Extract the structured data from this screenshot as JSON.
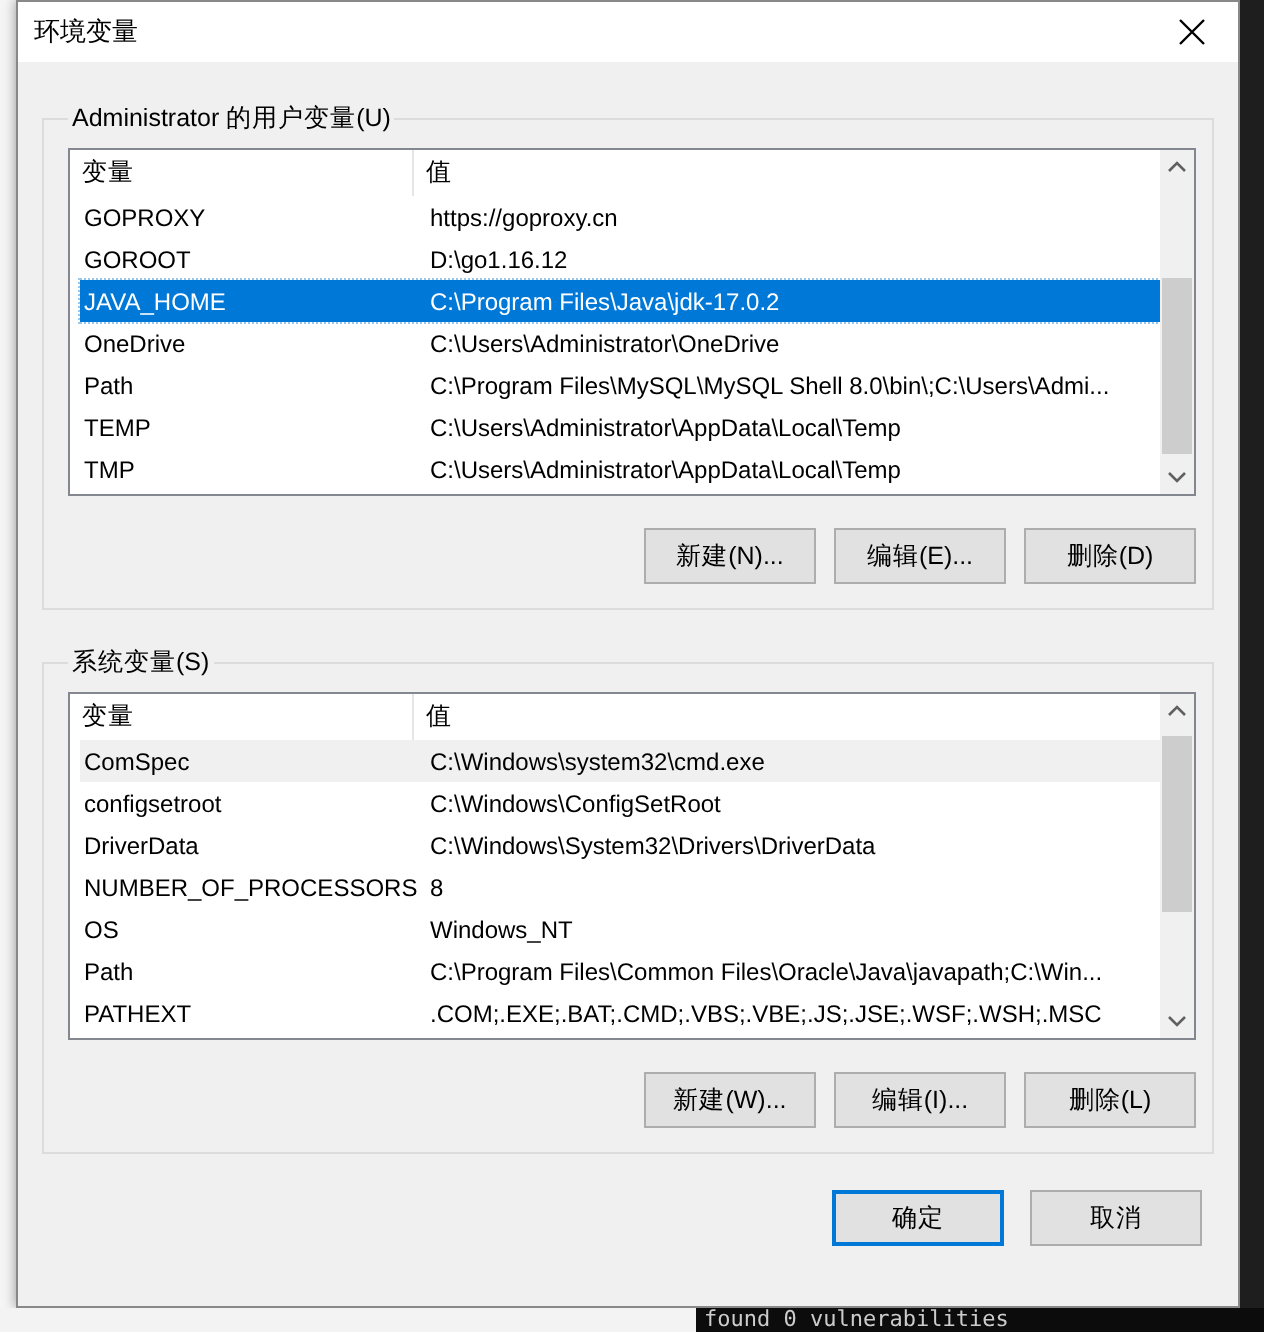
{
  "window": {
    "title": "环境变量"
  },
  "user_variables": {
    "title": "Administrator 的用户变量(U)",
    "columns": [
      "变量",
      "值"
    ],
    "rows": [
      {
        "name": "GOPROXY",
        "value": "https://goproxy.cn",
        "selected": false,
        "hovered": false
      },
      {
        "name": "GOROOT",
        "value": "D:\\go1.16.12",
        "selected": false,
        "hovered": false
      },
      {
        "name": "JAVA_HOME",
        "value": "C:\\Program Files\\Java\\jdk-17.0.2",
        "selected": true,
        "hovered": false
      },
      {
        "name": "OneDrive",
        "value": "C:\\Users\\Administrator\\OneDrive",
        "selected": false,
        "hovered": false
      },
      {
        "name": "Path",
        "value": "C:\\Program Files\\MySQL\\MySQL Shell 8.0\\bin\\;C:\\Users\\Admi...",
        "selected": false,
        "hovered": false
      },
      {
        "name": "TEMP",
        "value": "C:\\Users\\Administrator\\AppData\\Local\\Temp",
        "selected": false,
        "hovered": false
      },
      {
        "name": "TMP",
        "value": "C:\\Users\\Administrator\\AppData\\Local\\Temp",
        "selected": false,
        "hovered": false
      }
    ],
    "buttons": [
      "新建(N)...",
      "编辑(E)...",
      "删除(D)"
    ]
  },
  "system_variables": {
    "title": "系统变量(S)",
    "columns": [
      "变量",
      "值"
    ],
    "rows": [
      {
        "name": "ComSpec",
        "value": "C:\\Windows\\system32\\cmd.exe",
        "selected": false,
        "hovered": true
      },
      {
        "name": "configsetroot",
        "value": "C:\\Windows\\ConfigSetRoot",
        "selected": false,
        "hovered": false
      },
      {
        "name": "DriverData",
        "value": "C:\\Windows\\System32\\Drivers\\DriverData",
        "selected": false,
        "hovered": false
      },
      {
        "name": "NUMBER_OF_PROCESSORS",
        "value": "8",
        "selected": false,
        "hovered": false
      },
      {
        "name": "OS",
        "value": "Windows_NT",
        "selected": false,
        "hovered": false
      },
      {
        "name": "Path",
        "value": "C:\\Program Files\\Common Files\\Oracle\\Java\\javapath;C:\\Win...",
        "selected": false,
        "hovered": false
      },
      {
        "name": "PATHEXT",
        "value": ".COM;.EXE;.BAT;.CMD;.VBS;.VBE;.JS;.JSE;.WSF;.WSH;.MSC",
        "selected": false,
        "hovered": false
      }
    ],
    "buttons": [
      "新建(W)...",
      "编辑(I)...",
      "删除(L)"
    ]
  },
  "dialog_buttons": [
    {
      "label": "确定",
      "default": true
    },
    {
      "label": "取消",
      "default": false
    }
  ],
  "terminal": {
    "line": "found 0 vulnerabilities"
  }
}
